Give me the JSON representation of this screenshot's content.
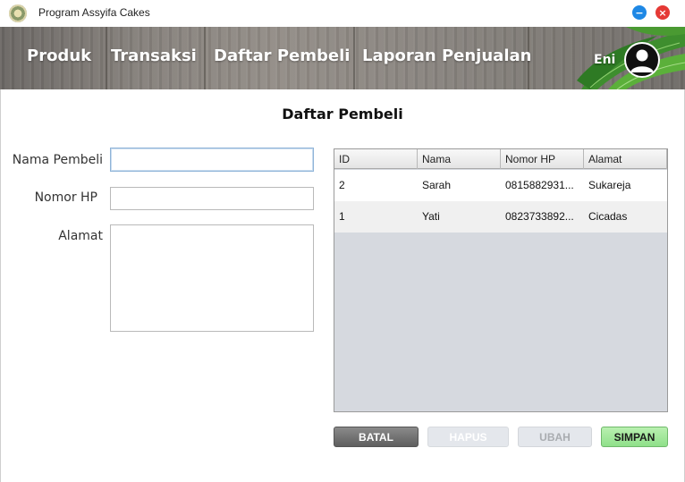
{
  "window": {
    "title": "Program Assyifa Cakes",
    "minimize_glyph": "−",
    "close_glyph": "×"
  },
  "nav": {
    "items": [
      {
        "label": "Produk"
      },
      {
        "label": "Transaksi"
      },
      {
        "label": "Daftar Pembeli"
      },
      {
        "label": "Laporan Penjualan"
      }
    ]
  },
  "user": {
    "name": "Eni"
  },
  "page": {
    "title": "Daftar Pembeli"
  },
  "form": {
    "nama_label": "Nama Pembeli",
    "nama_value": "",
    "hp_label": "Nomor HP",
    "hp_value": "",
    "alamat_label": "Alamat",
    "alamat_value": ""
  },
  "table": {
    "columns": [
      "ID",
      "Nama",
      "Nomor HP",
      "Alamat"
    ],
    "rows": [
      {
        "id": "2",
        "nama": "Sarah",
        "hp": "0815882931...",
        "alamat": "Sukareja"
      },
      {
        "id": "1",
        "nama": "Yati",
        "hp": "0823733892...",
        "alamat": "Cicadas"
      }
    ]
  },
  "buttons": {
    "batal": "BATAL",
    "hapus": "HAPUS",
    "ubah": "UBAH",
    "simpan": "SIMPAN"
  },
  "colors": {
    "minimize": "#1e88e5",
    "close": "#e53935",
    "simpan": "#8fe08a",
    "batal": "#6b6b6b"
  },
  "icons": [
    "app-logo-icon",
    "minimize-icon",
    "close-icon",
    "user-avatar-icon",
    "leaves-decoration"
  ]
}
